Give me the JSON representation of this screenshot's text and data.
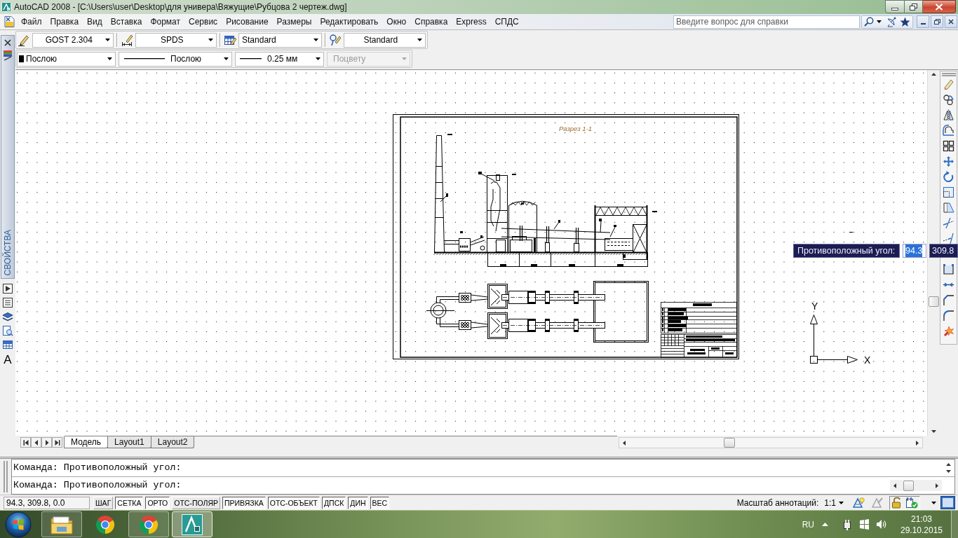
{
  "window": {
    "title": "AutoCAD 2008 - [C:\\Users\\user\\Desktop\\для универа\\Вяжущие\\Рубцова 2 чертеж.dwg]"
  },
  "menu_bar": {
    "items": [
      "Файл",
      "Правка",
      "Вид",
      "Вставка",
      "Формат",
      "Сервис",
      "Рисование",
      "Размеры",
      "Редактировать",
      "Окно",
      "Справка",
      "Express",
      "СПДС"
    ],
    "help_search": {
      "placeholder": "Введите вопрос для справки"
    }
  },
  "styles_toolbar": {
    "items": [
      {
        "kind": "text-style",
        "value": "GOST 2.304"
      },
      {
        "kind": "dimension-style",
        "value": "SPDS"
      },
      {
        "kind": "table-style",
        "value": "Standard"
      },
      {
        "kind": "multileader-style",
        "value": "Standard"
      }
    ]
  },
  "properties_toolbar": {
    "items": [
      {
        "kind": "color",
        "value": "Послою",
        "disabled": false
      },
      {
        "kind": "linetype",
        "value": "Послою",
        "disabled": false
      },
      {
        "kind": "lineweight",
        "value": "0.25 мм",
        "disabled": false
      },
      {
        "kind": "plot-style",
        "value": "Поцвету",
        "disabled": true
      }
    ]
  },
  "properties_palette": {
    "title": "СВОЙСТВА",
    "text_tool": "A"
  },
  "drawing": {
    "section_title": "Разрез 1-1",
    "ucs": {
      "x_label": "X",
      "y_label": "Y"
    }
  },
  "dynamic_input": {
    "prompt": "Противоположный угол:",
    "fields": [
      {
        "value": "94.3",
        "selected": true
      },
      {
        "value": "309.8",
        "selected": false
      }
    ]
  },
  "layout_tabs": [
    {
      "label": "Модель",
      "selected": true
    },
    {
      "label": "Layout1",
      "selected": false
    },
    {
      "label": "Layout2",
      "selected": false
    }
  ],
  "command_window": {
    "lines": [
      "Команда: Противоположный угол:",
      "Команда: Противоположный угол:"
    ]
  },
  "status_bar": {
    "coordinates": "94.3, 309.8, 0.0",
    "toggles": [
      {
        "label": "ШАГ",
        "on": false
      },
      {
        "label": "СЕТКА",
        "on": true
      },
      {
        "label": "ОРТО",
        "on": true
      },
      {
        "label": "ОТС-ПОЛЯР",
        "on": false
      },
      {
        "label": "ПРИВЯЗКА",
        "on": true
      },
      {
        "label": "ОТС-ОБЪЕКТ",
        "on": true
      },
      {
        "label": "ДПСК",
        "on": true
      },
      {
        "label": "ДИН",
        "on": true
      },
      {
        "label": "ВЕС",
        "on": true
      }
    ],
    "annotation_scale": {
      "label": "Масштаб аннотаций:",
      "value": "1:1"
    }
  },
  "taskbar": {
    "apps": [
      {
        "kind": "explorer",
        "running": true,
        "active": false
      },
      {
        "kind": "browser",
        "running": false,
        "active": false
      },
      {
        "kind": "browser",
        "running": true,
        "active": false
      },
      {
        "kind": "cad",
        "running": true,
        "active": true
      }
    ],
    "language": "RU",
    "time": "21:03",
    "date": "29.10.2015"
  }
}
